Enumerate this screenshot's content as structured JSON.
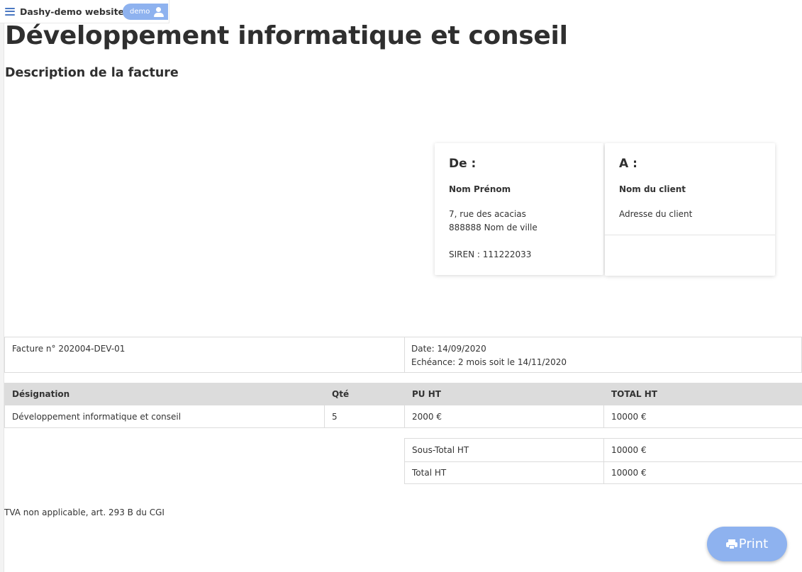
{
  "header": {
    "app_title": "Dashy-demo website",
    "user_label": "demo"
  },
  "page": {
    "title": "Développement informatique et conseil",
    "subtitle": "Description de la facture"
  },
  "from": {
    "heading": "De :",
    "name": "Nom Prénom",
    "address_line1": "7, rue des acacias",
    "address_line2": "888888 Nom de ville",
    "siren": "SIREN : 111222033"
  },
  "to": {
    "heading": "A :",
    "name": "Nom du client",
    "address": "Adresse du client"
  },
  "invoice": {
    "number": "Facture n° 202004-DEV-01",
    "date": "Date: 14/09/2020",
    "due": "Echéance: 2 mois soit le 14/11/2020"
  },
  "lines": {
    "headers": [
      "Désignation",
      "Qté",
      "PU HT",
      "TOTAL HT"
    ],
    "rows": [
      [
        "Développement informatique et conseil",
        "5",
        "2000 €",
        "10000 €"
      ]
    ]
  },
  "totals": {
    "subtotal_label": "Sous-Total HT",
    "subtotal_value": "10000 €",
    "total_label": "Total HT",
    "total_value": "10000 €"
  },
  "tva_note": "TVA non applicable, art. 293 B du CGI",
  "print_label": "Print"
}
